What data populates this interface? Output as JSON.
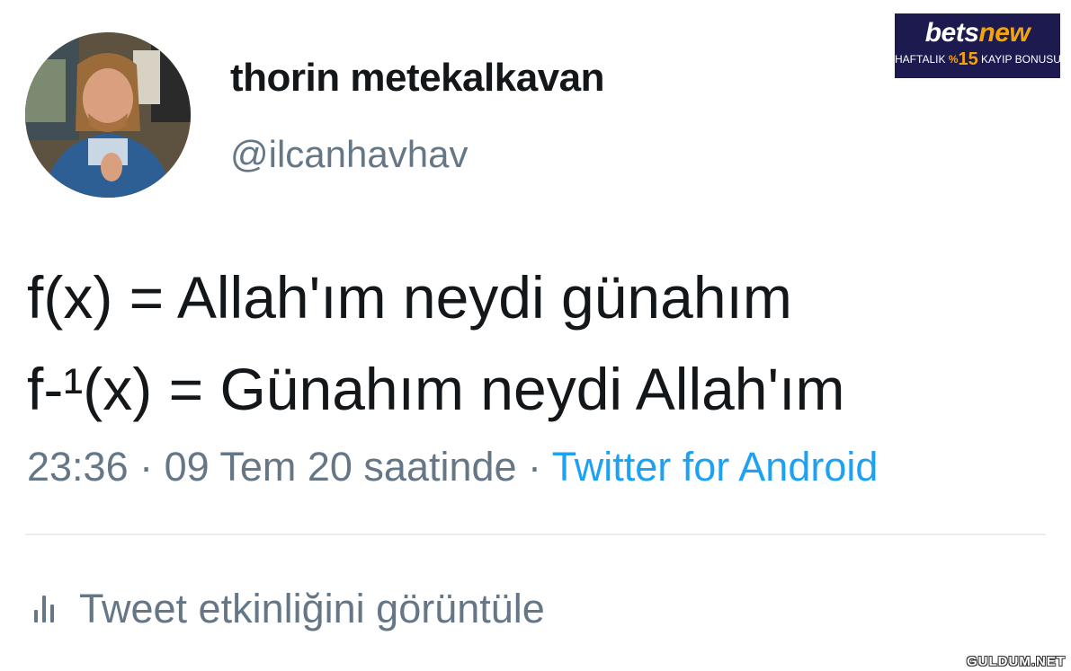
{
  "tweet": {
    "author": {
      "display_name": "thorin metekalkavan",
      "handle": "@ilcanhavhav"
    },
    "text_lines": [
      "f(x) = Allah'ım neydi günahım",
      "f-¹(x) = Günahım neydi Allah'ım"
    ],
    "meta": {
      "time_date": "23:36 · 09 Tem 20 saatinde · ",
      "source": "Twitter for Android"
    },
    "activity_label": "Tweet etkinliğini görüntüle"
  },
  "ad_banner": {
    "brand_part1": "bets",
    "brand_part2": "new",
    "subtitle_before": "HAFTALIK ",
    "subtitle_percent": "%",
    "subtitle_number": "15",
    "subtitle_after": " KAYIP BONUSU"
  },
  "watermark": "GULDUM.NET",
  "colors": {
    "text_primary": "#14171a",
    "text_secondary": "#657786",
    "link": "#1da1f2",
    "divider": "#e6ecf0",
    "ad_background": "#1d1a4f",
    "ad_accent": "#f5a30a"
  }
}
